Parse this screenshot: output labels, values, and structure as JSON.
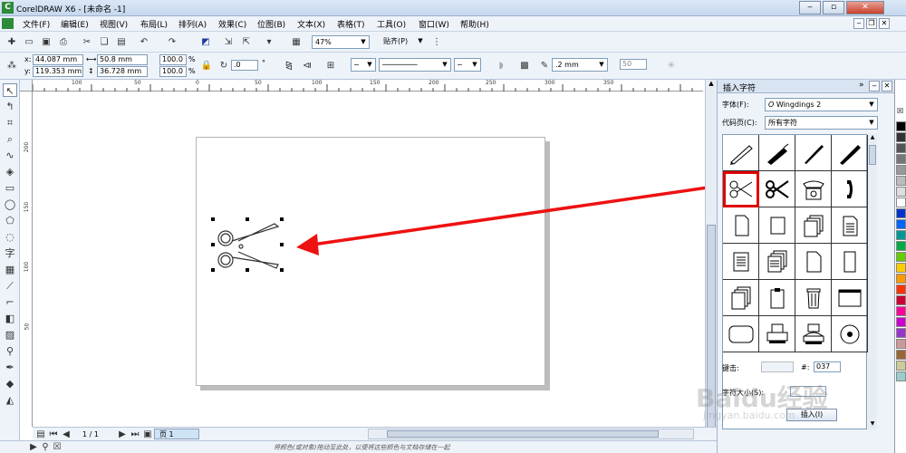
{
  "window": {
    "title": "CorelDRAW X6 - [未命名 -1]"
  },
  "menu": [
    "文件(F)",
    "编辑(E)",
    "视图(V)",
    "布局(L)",
    "排列(A)",
    "效果(C)",
    "位图(B)",
    "文本(X)",
    "表格(T)",
    "工具(O)",
    "窗口(W)",
    "帮助(H)"
  ],
  "toolbar": {
    "zoom": "47%",
    "snap_label": "贴齐(P)"
  },
  "property_bar": {
    "x": "44.087 mm",
    "y": "119.353 mm",
    "width": "50.8 mm",
    "height": "36.728 mm",
    "scale_x": "100.0",
    "scale_y": "100.0",
    "percent": "%",
    "rotation": ".0",
    "degree": "°",
    "outline_width": ".2 mm",
    "opacity": "50",
    "x_label": "x:",
    "y_label": "y:"
  },
  "rulers": {
    "h_ticks": [
      "100",
      "50",
      "0",
      "50",
      "100",
      "150",
      "200",
      "250",
      "300",
      "350"
    ],
    "v_ticks": [
      "200",
      "150",
      "100",
      "50"
    ]
  },
  "docker": {
    "title": "插入字符",
    "font_label": "字体(F):",
    "font_value": "Wingdings 2",
    "codepage_label": "代码页(C):",
    "codepage_value": "所有字符",
    "keystroke_label": "键击:",
    "hash_label": "#:",
    "code_value": "037",
    "size_label": "字符大小(S):",
    "insert_button": "插入(I)"
  },
  "page_nav": {
    "counter": "1 / 1",
    "page_tab": "页 1"
  },
  "status": {
    "hint": "将颜色(或对象)拖动至此处，以便将这些颜色与文档存储在一起"
  },
  "watermark": {
    "brand": "Baidu经验",
    "url": "jingyan.baidu.com"
  },
  "colors": {
    "highlight": "#e00000",
    "arrow": "#ee1111",
    "palette": [
      "#000000",
      "#333333",
      "#555555",
      "#777777",
      "#999999",
      "#bbbbbb",
      "#dddddd",
      "#ffffff",
      "#0033cc",
      "#0066ff",
      "#009999",
      "#00aa44",
      "#66cc00",
      "#ffcc00",
      "#ff9900",
      "#ff3300",
      "#cc0033",
      "#ff0099",
      "#cc00cc",
      "#9933cc",
      "#cc9999",
      "#996633",
      "#cccc99",
      "#99cccc"
    ]
  }
}
